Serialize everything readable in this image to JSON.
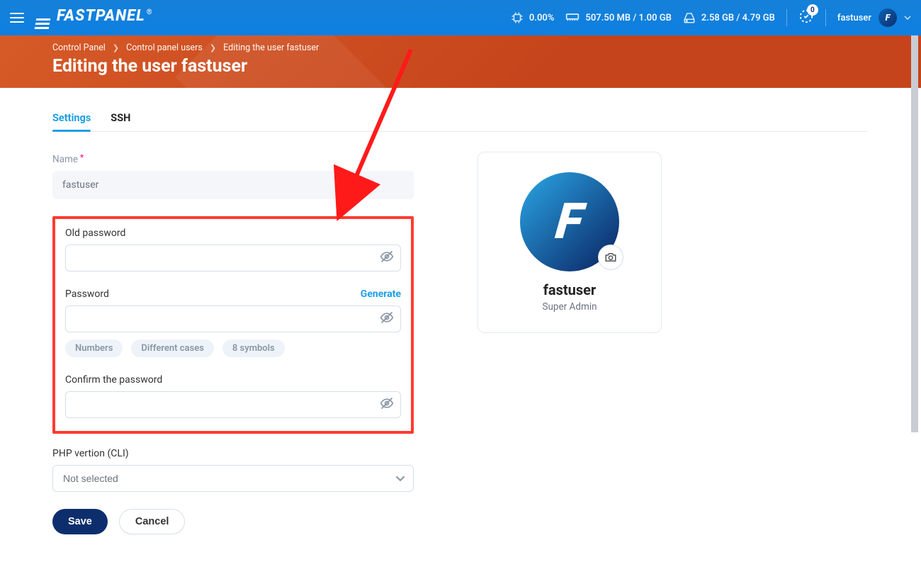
{
  "topbar": {
    "brand_main": "FASTPANEL",
    "brand_mark": "®",
    "cpu": "0.00%",
    "ram": "507.50 MB / 1.00 GB",
    "disk": "2.58 GB / 4.79 GB",
    "notif_count": "0",
    "user": "fastuser",
    "avatar_letter": "F"
  },
  "breadcrumbs": {
    "a": "Control Panel",
    "b": "Control panel users",
    "c": "Editing the user fastuser"
  },
  "pagetitle": "Editing the user fastuser",
  "tabs": {
    "settings": "Settings",
    "ssh": "SSH"
  },
  "form": {
    "name_label": "Name",
    "name_value": "fastuser",
    "old_password_label": "Old password",
    "password_label": "Password",
    "generate_label": "Generate",
    "confirm_label": "Confirm the password",
    "chip_numbers": "Numbers",
    "chip_cases": "Different cases",
    "chip_symbols": "8 symbols",
    "php_label": "PHP vertion (CLI)",
    "php_value": "Not selected",
    "save": "Save",
    "cancel": "Cancel"
  },
  "card": {
    "avatar_letter": "F",
    "name": "fastuser",
    "role": "Super Admin"
  }
}
